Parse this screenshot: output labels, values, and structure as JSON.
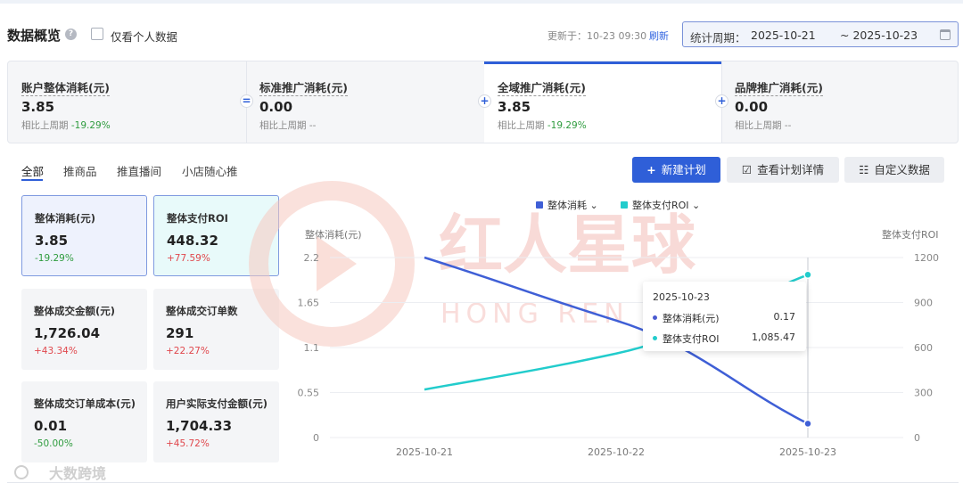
{
  "header": {
    "title": "数据概览",
    "only_personal_label": "仅看个人数据",
    "updated_text": "更新于：10-23 09:30",
    "refresh_label": "刷新",
    "period_label": "统计周期：",
    "period_start": "2025-10-21",
    "period_end": "~ 2025-10-23"
  },
  "summary": {
    "cards": [
      {
        "title": "账户整体消耗(元)",
        "value": "3.85",
        "compare_label": "相比上周期",
        "compare_value": "-19.29%"
      },
      {
        "title": "标准推广消耗(元)",
        "value": "0.00",
        "compare_label": "相比上周期",
        "compare_value": "--"
      },
      {
        "title": "全域推广消耗(元)",
        "value": "3.85",
        "compare_label": "相比上周期",
        "compare_value": "-19.29%"
      },
      {
        "title": "品牌推广消耗(元)",
        "value": "0.00",
        "compare_label": "相比上周期",
        "compare_value": "--"
      }
    ],
    "operators": [
      "=",
      "+",
      "+"
    ]
  },
  "tabs": [
    "全部",
    "推商品",
    "推直播间",
    "小店随心推"
  ],
  "actions": {
    "new_plan": "新建计划",
    "view_plan_detail": "查看计划详情",
    "custom_data": "自定义数据"
  },
  "metrics": [
    {
      "title": "整体消耗(元)",
      "value": "3.85",
      "change": "-19.29%",
      "trend": "down"
    },
    {
      "title": "整体支付ROI",
      "value": "448.32",
      "change": "+77.59%",
      "trend": "up"
    },
    {
      "title": "整体成交金额(元)",
      "value": "1,726.04",
      "change": "+43.34%",
      "trend": "up"
    },
    {
      "title": "整体成交订单数",
      "value": "291",
      "change": "+22.27%",
      "trend": "up"
    },
    {
      "title": "整体成交订单成本(元)",
      "value": "0.01",
      "change": "-50.00%",
      "trend": "down"
    },
    {
      "title": "用户实际支付金额(元)",
      "value": "1,704.33",
      "change": "+45.72%",
      "trend": "up"
    }
  ],
  "chart_data": {
    "type": "line",
    "x": [
      "2025-10-21",
      "2025-10-22",
      "2025-10-23"
    ],
    "left_axis_label": "整体消耗(元)",
    "right_axis_label": "整体支付ROI",
    "left_ticks": [
      "0",
      "0.55",
      "1.1",
      "1.65",
      "2.2"
    ],
    "right_ticks": [
      "0",
      "300",
      "600",
      "900",
      "1200"
    ],
    "left_ylim": [
      0,
      2.2
    ],
    "right_ylim": [
      0,
      1200
    ],
    "series": [
      {
        "name": "整体消耗",
        "axis": "left",
        "color": "#3f5fd6",
        "values": [
          2.2,
          1.43,
          0.17
        ]
      },
      {
        "name": "整体支付ROI",
        "axis": "right",
        "color": "#22cccc",
        "values": [
          320,
          560,
          1085.47
        ]
      }
    ],
    "legend": [
      "整体消耗",
      "整体支付ROI"
    ]
  },
  "tooltip": {
    "date": "2025-10-23",
    "rows": [
      {
        "label": "整体消耗(元)",
        "value": "0.17",
        "color": "#4a5bd0"
      },
      {
        "label": "整体支付ROI",
        "value": "1,085.47",
        "color": "#22cccc"
      }
    ]
  },
  "watermark": {
    "main": "红人星球",
    "sub": "HONG REN XING QIU",
    "corner": "大数跨境"
  }
}
